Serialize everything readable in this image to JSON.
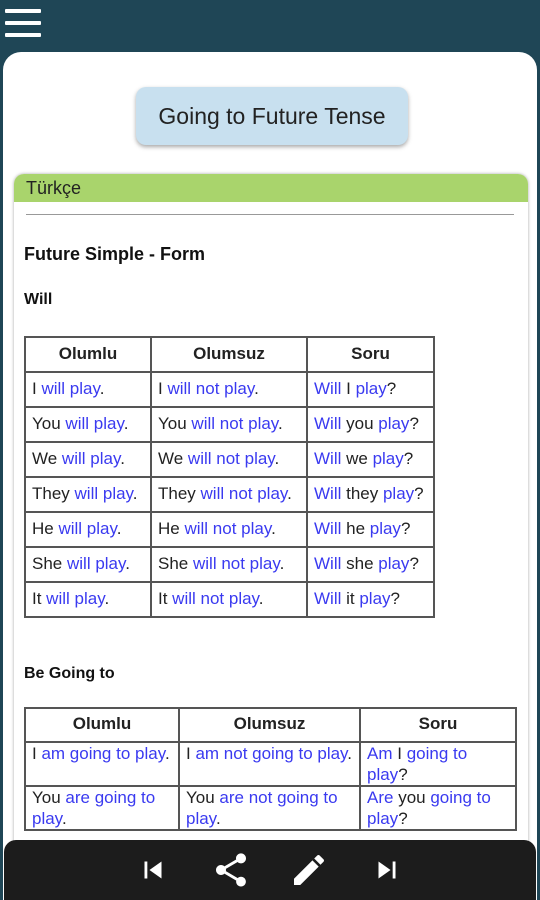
{
  "title": "Going to Future Tense",
  "card": {
    "header": "Türkçe"
  },
  "section_title": "Future Simple - Form",
  "will": {
    "heading": "Will",
    "headers": [
      "Olumlu",
      "Olumsuz",
      "Soru"
    ],
    "rows": [
      [
        {
          "p": "I ",
          "h": "will play",
          "s": "."
        },
        {
          "p": "I ",
          "h": "will not play",
          "s": "."
        },
        {
          "p": "Will ",
          "h": "",
          "s": "I ",
          "h2": "play",
          "s2": "?"
        }
      ],
      [
        {
          "p": "You ",
          "h": "will play",
          "s": "."
        },
        {
          "p": "You ",
          "h": "will not play",
          "s": "."
        },
        {
          "p": "Will ",
          "h": "",
          "s": "you ",
          "h2": "play",
          "s2": "?"
        }
      ],
      [
        {
          "p": "We ",
          "h": "will play",
          "s": "."
        },
        {
          "p": "We ",
          "h": "will not play",
          "s": "."
        },
        {
          "p": "Will ",
          "h": "",
          "s": "we ",
          "h2": "play",
          "s2": "?"
        }
      ],
      [
        {
          "p": "They ",
          "h": "will play",
          "s": "."
        },
        {
          "p": "They ",
          "h": "will not play",
          "s": "."
        },
        {
          "p": "Will ",
          "h": "",
          "s": "they ",
          "h2": "play",
          "s2": "?"
        }
      ],
      [
        {
          "p": "He ",
          "h": "will play",
          "s": "."
        },
        {
          "p": "He ",
          "h": "will not play",
          "s": "."
        },
        {
          "p": "Will ",
          "h": "",
          "s": "he ",
          "h2": "play",
          "s2": "?"
        }
      ],
      [
        {
          "p": "She ",
          "h": "will play",
          "s": "."
        },
        {
          "p": "She ",
          "h": "will not play",
          "s": "."
        },
        {
          "p": "Will ",
          "h": "",
          "s": "she ",
          "h2": "play",
          "s2": "?"
        }
      ],
      [
        {
          "p": "It ",
          "h": "will play",
          "s": "."
        },
        {
          "p": "It ",
          "h": "will not play",
          "s": "."
        },
        {
          "p": "Will ",
          "h": "",
          "s": "it ",
          "h2": "play",
          "s2": "?"
        }
      ]
    ]
  },
  "going": {
    "heading": "Be Going to",
    "headers": [
      "Olumlu",
      "Olumsuz",
      "Soru"
    ],
    "rows": [
      [
        {
          "p": "I ",
          "h": "am going to play",
          "s": "."
        },
        {
          "p": "I ",
          "h": "am not going to play",
          "s": "."
        },
        {
          "p": "Am ",
          "h": "",
          "s": "I ",
          "h2": "going to play",
          "s2": "?"
        }
      ],
      [
        {
          "p": "You ",
          "h": "are going to play",
          "s": "."
        },
        {
          "p": "You ",
          "h": "are not going to play",
          "s": "."
        },
        {
          "p": "Are ",
          "h": "",
          "s": "you ",
          "h2": "going to play",
          "s2": "?"
        }
      ]
    ]
  },
  "icons": {
    "menu": "menu-icon",
    "prev": "skip-previous-icon",
    "share": "share-icon",
    "edit": "pencil-icon",
    "next": "skip-next-icon"
  },
  "colors": {
    "appbar": "#1f4656",
    "highlight": "#3a3af0",
    "card_header": "#a9d46c",
    "title_button": "#c8e0ef",
    "bottom_bar": "#1c1c1c"
  }
}
